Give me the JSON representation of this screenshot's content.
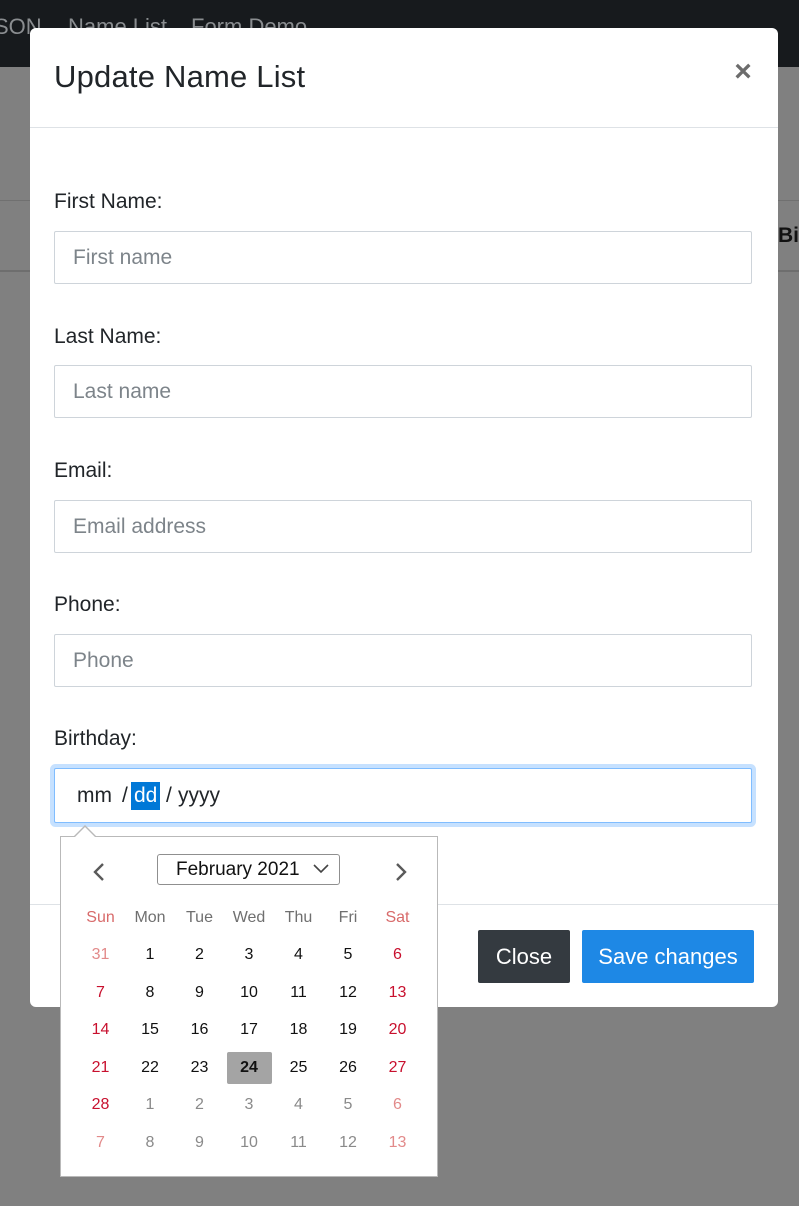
{
  "navbar": {
    "brand": "SON",
    "links": [
      "Name List",
      "Form Demo"
    ]
  },
  "background": {
    "column_header": "Bi"
  },
  "modal": {
    "title": "Update Name List",
    "close_symbol": "×",
    "fields": {
      "first_name": {
        "label": "First Name:",
        "placeholder": "First name",
        "value": ""
      },
      "last_name": {
        "label": "Last Name:",
        "placeholder": "Last name",
        "value": ""
      },
      "email": {
        "label": "Email:",
        "placeholder": "Email address",
        "value": ""
      },
      "phone": {
        "label": "Phone:",
        "placeholder": "Phone",
        "value": ""
      },
      "birthday": {
        "label": "Birthday:",
        "mm": "mm",
        "sep": "/",
        "dd": "dd",
        "yyyy": "yyyy"
      }
    },
    "buttons": {
      "close": "Close",
      "save": "Save changes"
    }
  },
  "calendar": {
    "month_label": "February 2021",
    "weekdays": [
      "Sun",
      "Mon",
      "Tue",
      "Wed",
      "Thu",
      "Fri",
      "Sat"
    ],
    "weeks": [
      [
        {
          "d": "31",
          "other": true
        },
        {
          "d": "1"
        },
        {
          "d": "2"
        },
        {
          "d": "3"
        },
        {
          "d": "4"
        },
        {
          "d": "5"
        },
        {
          "d": "6"
        }
      ],
      [
        {
          "d": "7"
        },
        {
          "d": "8"
        },
        {
          "d": "9"
        },
        {
          "d": "10"
        },
        {
          "d": "11"
        },
        {
          "d": "12"
        },
        {
          "d": "13"
        }
      ],
      [
        {
          "d": "14"
        },
        {
          "d": "15"
        },
        {
          "d": "16"
        },
        {
          "d": "17"
        },
        {
          "d": "18"
        },
        {
          "d": "19"
        },
        {
          "d": "20"
        }
      ],
      [
        {
          "d": "21"
        },
        {
          "d": "22"
        },
        {
          "d": "23"
        },
        {
          "d": "24",
          "today": true
        },
        {
          "d": "25"
        },
        {
          "d": "26"
        },
        {
          "d": "27"
        }
      ],
      [
        {
          "d": "28"
        },
        {
          "d": "1",
          "other": true
        },
        {
          "d": "2",
          "other": true
        },
        {
          "d": "3",
          "other": true
        },
        {
          "d": "4",
          "other": true
        },
        {
          "d": "5",
          "other": true
        },
        {
          "d": "6",
          "other": true
        }
      ],
      [
        {
          "d": "7",
          "other": true
        },
        {
          "d": "8",
          "other": true
        },
        {
          "d": "9",
          "other": true
        },
        {
          "d": "10",
          "other": true
        },
        {
          "d": "11",
          "other": true
        },
        {
          "d": "12",
          "other": true
        },
        {
          "d": "13",
          "other": true
        }
      ]
    ],
    "icons": {
      "prev": "chevron-left-icon",
      "next": "chevron-right-icon",
      "dropdown": "chevron-down-icon"
    }
  },
  "colors": {
    "primary": "#1e88e5",
    "dark": "#343a40",
    "selection": "#0078d7",
    "weekend": "#c8102e",
    "today_bg": "#a4a4a4"
  }
}
